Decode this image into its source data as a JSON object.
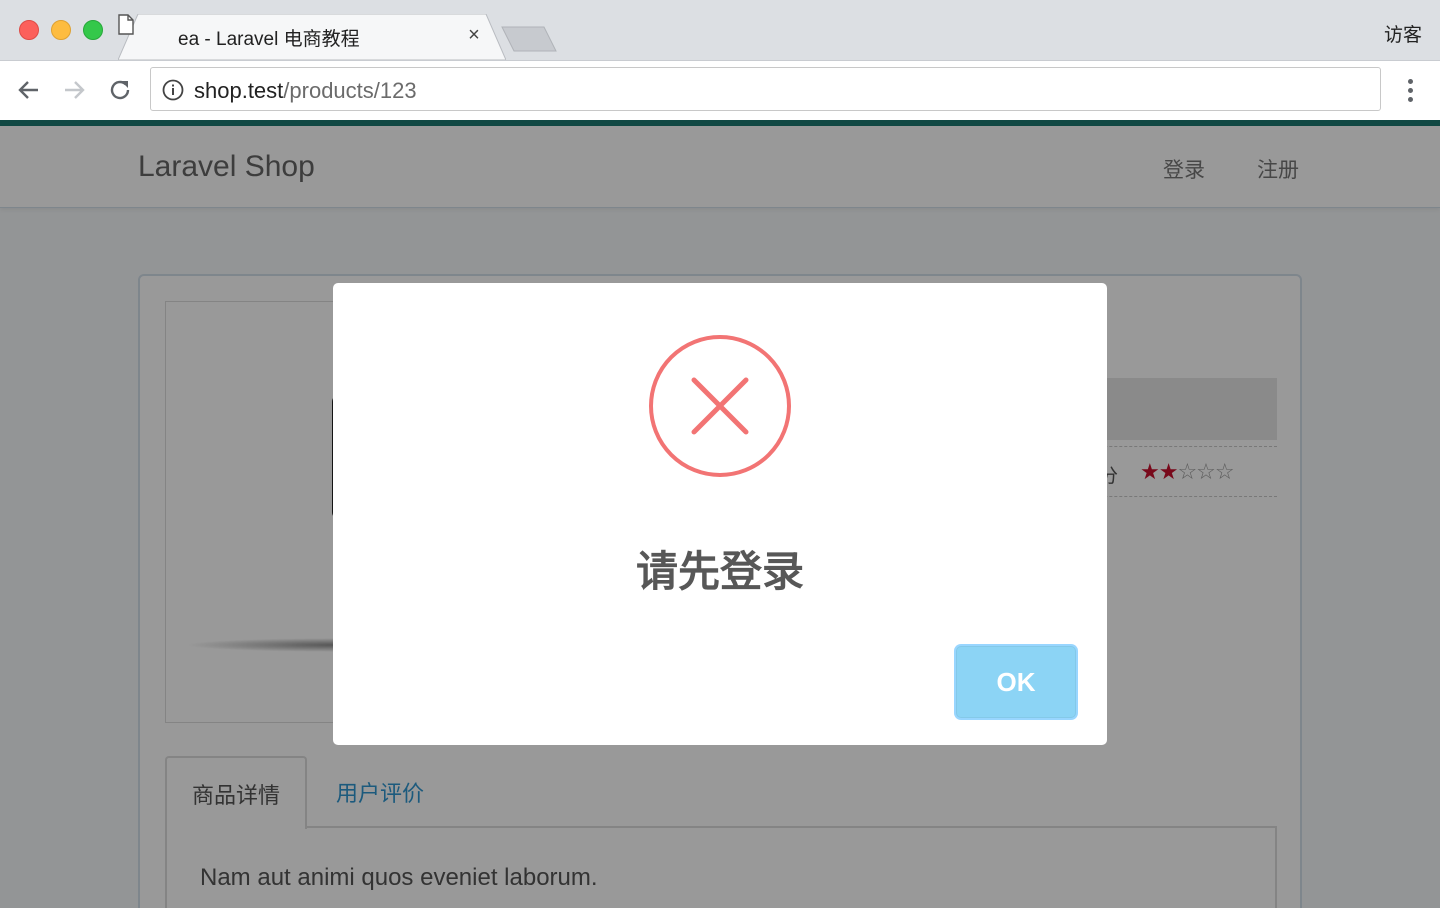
{
  "browser": {
    "tab_title": "ea - Laravel 电商教程",
    "tab_close": "×",
    "profile_name": "访客",
    "url_host": "shop.test",
    "url_path": "/products/123"
  },
  "navbar": {
    "brand": "Laravel Shop",
    "login": "登录",
    "register": "注册"
  },
  "product": {
    "rating_label": "评分",
    "rating": {
      "filled": 2,
      "total": 5
    },
    "stars_filled": "★★",
    "stars_empty": "☆☆☆",
    "tabs": [
      {
        "label": "商品详情",
        "active": true
      },
      {
        "label": "用户评价",
        "active": false
      }
    ],
    "description": "Nam aut animi quos eveniet laborum."
  },
  "modal": {
    "icon": "error-x-circle-icon",
    "title": "请先登录",
    "ok_label": "OK"
  },
  "colors": {
    "accent_bar": "#1d7a72",
    "error_icon": "#f27474",
    "ok_button": "#8cd4f5",
    "link": "#3097d1",
    "star": "#c8102e"
  }
}
